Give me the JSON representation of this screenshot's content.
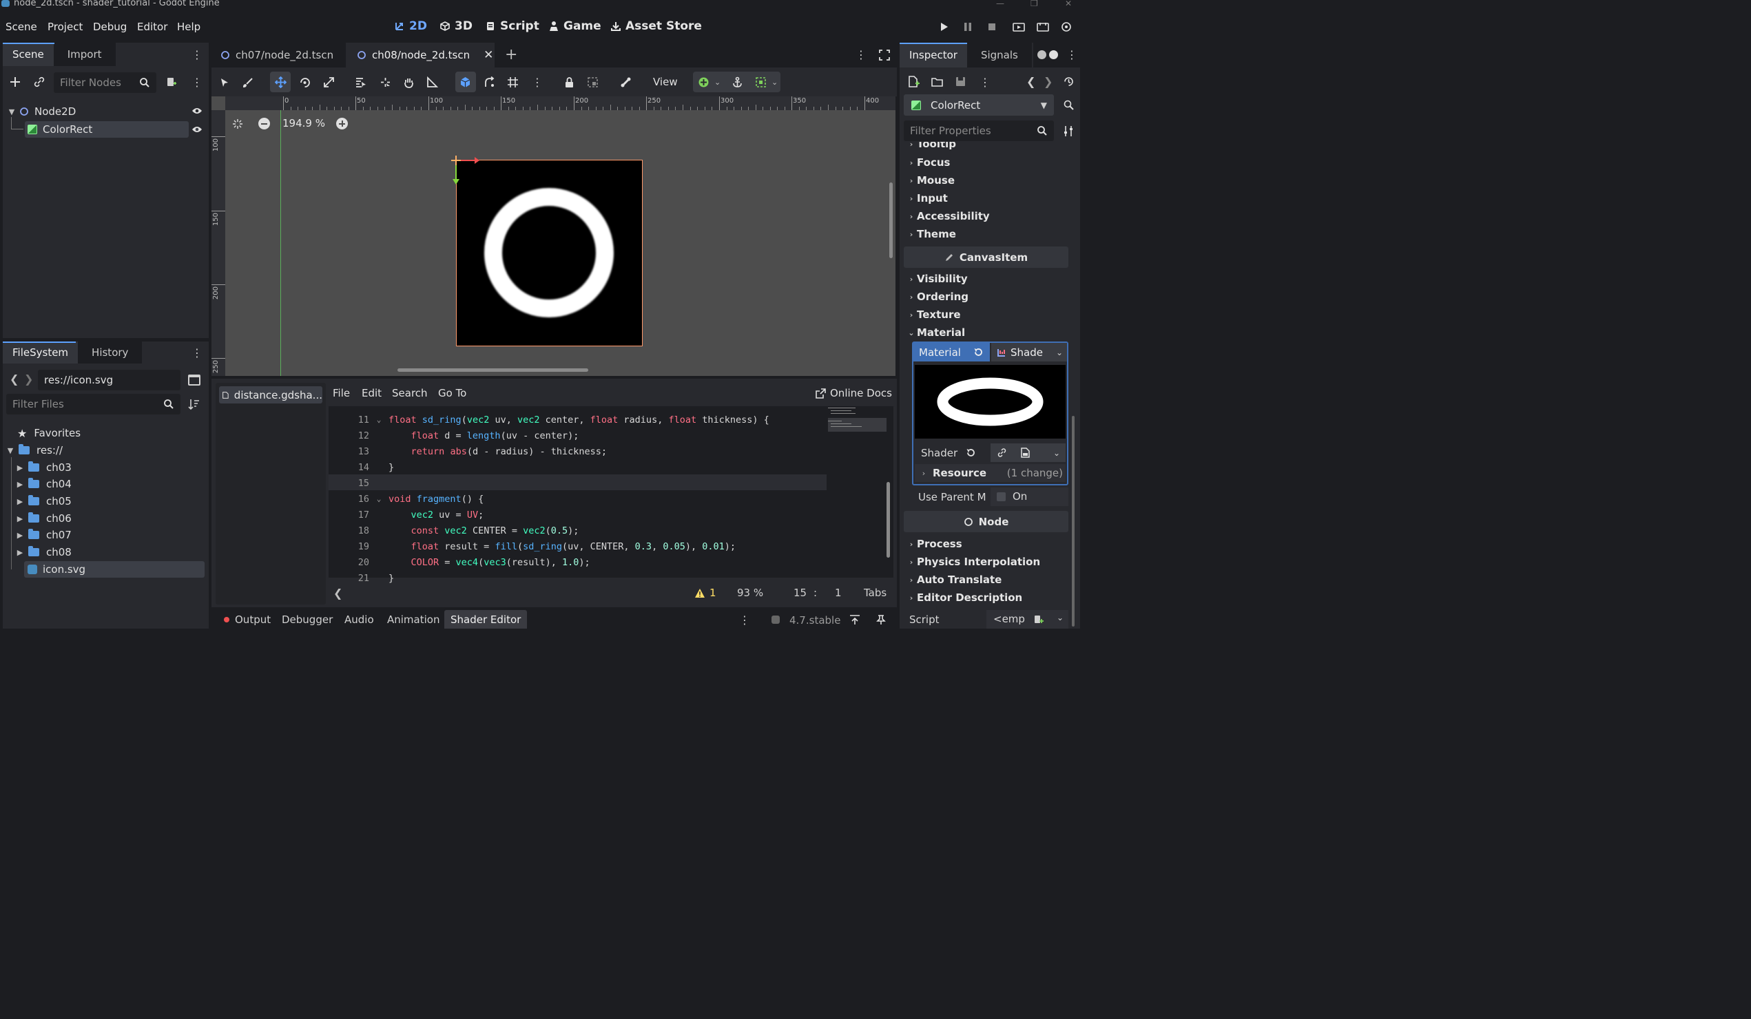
{
  "window": {
    "title": "node_2d.tscn - shader_tutorial - Godot Engine"
  },
  "menu": {
    "items": [
      "Scene",
      "Project",
      "Debug",
      "Editor",
      "Help"
    ]
  },
  "workspaces": [
    {
      "label": "2D",
      "active": true
    },
    {
      "label": "3D",
      "active": false
    },
    {
      "label": "Script",
      "active": false
    },
    {
      "label": "Game",
      "active": false
    },
    {
      "label": "Asset Store",
      "active": false
    }
  ],
  "scene_dock": {
    "tabs": [
      "Scene",
      "Import"
    ],
    "filter_placeholder": "Filter Nodes",
    "nodes": [
      {
        "label": "Node2D",
        "type": "Node2D"
      },
      {
        "label": "ColorRect",
        "type": "ColorRect",
        "selected": true
      }
    ]
  },
  "filesystem_dock": {
    "tabs": [
      "FileSystem",
      "History"
    ],
    "path": "res://icon.svg",
    "filter_placeholder": "Filter Files",
    "favorites_label": "Favorites",
    "root_label": "res://",
    "folders": [
      "ch03",
      "ch04",
      "ch05",
      "ch06",
      "ch07",
      "ch08"
    ],
    "file": "icon.svg"
  },
  "scene_tabs": [
    {
      "label": "ch07/node_2d.tscn",
      "active": false
    },
    {
      "label": "ch08/node_2d.tscn",
      "active": true
    }
  ],
  "toolbar": {
    "view_label": "View"
  },
  "viewport": {
    "zoom_label": "194.9 %",
    "ruler_h": [
      "0",
      "50",
      "100",
      "150",
      "200",
      "250",
      "300",
      "350",
      "400"
    ],
    "ruler_v": [
      "100",
      "150",
      "200",
      "250"
    ]
  },
  "shader_editor": {
    "file_tab": "distance.gdsha...",
    "menu": [
      "File",
      "Edit",
      "Search",
      "Go To"
    ],
    "online_docs": "Online Docs",
    "lines": [
      {
        "n": "11",
        "fold": true,
        "html": "<span class='kw'>float</span> <span class='fn'>sd_ring</span><span class='tx'>(</span><span class='ty'>vec2</span><span class='tx'> uv, </span><span class='ty'>vec2</span><span class='tx'> center, </span><span class='kw'>float</span><span class='tx'> radius, </span><span class='kw'>float</span><span class='tx'> thickness) {</span>"
      },
      {
        "n": "12",
        "fold": false,
        "html": "<span class='tx'>    </span><span class='kw'>float</span><span class='tx'> d = </span><span class='fn'>length</span><span class='tx'>(uv - center);</span>"
      },
      {
        "n": "13",
        "fold": false,
        "html": "<span class='tx'>    </span><span class='kw'>return</span><span class='tx'> </span><span class='kw'>abs</span><span class='tx'>(d - radius) - thickness;</span>"
      },
      {
        "n": "14",
        "fold": false,
        "html": "<span class='tx'>}</span>"
      },
      {
        "n": "15",
        "fold": false,
        "html": ""
      },
      {
        "n": "16",
        "fold": true,
        "html": "<span class='kw'>void</span><span class='tx'> </span><span class='fn'>fragment</span><span class='tx'>() {</span>"
      },
      {
        "n": "17",
        "fold": false,
        "html": "<span class='tx'>    </span><span class='ty'>vec2</span><span class='tx'> uv = </span><span class='kw'>UV</span><span class='tx'>;</span>"
      },
      {
        "n": "18",
        "fold": false,
        "html": "<span class='tx'>    </span><span class='kw'>const</span><span class='tx'> </span><span class='ty'>vec2</span><span class='tx'> CENTER = </span><span class='ty'>vec2</span><span class='tx'>(</span><span class='nm'>0.5</span><span class='tx'>);</span>"
      },
      {
        "n": "19",
        "fold": false,
        "html": "<span class='tx'>    </span><span class='kw'>float</span><span class='tx'> result = </span><span class='fn'>fill</span><span class='tx'>(</span><span class='fn'>sd_ring</span><span class='tx'>(uv, CENTER, </span><span class='nm'>0.3</span><span class='tx'>, </span><span class='nm'>0.05</span><span class='tx'>), </span><span class='nm'>0.01</span><span class='tx'>);</span>"
      },
      {
        "n": "20",
        "fold": false,
        "html": "<span class='tx'>    </span><span class='kw'>COLOR</span><span class='tx'> = </span><span class='ty'>vec4</span><span class='tx'>(</span><span class='ty'>vec3</span><span class='tx'>(result), </span><span class='nm'>1.0</span><span class='tx'>);</span>"
      },
      {
        "n": "21",
        "fold": false,
        "html": "<span class='tx'>}</span>"
      }
    ],
    "status": {
      "warnings": "1",
      "zoom": "93 %",
      "line": "15",
      "sep": ":",
      "col": "1",
      "indent": "Tabs"
    }
  },
  "bottom_tabs": [
    "Output",
    "Debugger",
    "Audio",
    "Animation",
    "Shader Editor"
  ],
  "version": "4.7.stable",
  "inspector": {
    "tabs": [
      "Inspector",
      "Signals"
    ],
    "object": "ColorRect",
    "filter_placeholder": "Filter Properties",
    "sections_top": [
      "Tooltip",
      "Focus",
      "Mouse",
      "Input",
      "Accessibility",
      "Theme"
    ],
    "category_canvasitem": "CanvasItem",
    "sections_canvas": [
      "Visibility",
      "Ordering",
      "Texture",
      "Material"
    ],
    "material_label": "Material",
    "material_value": "Shade",
    "shader_label": "Shader",
    "resource_label": "Resource",
    "resource_changes": "(1 change)",
    "use_parent_label": "Use Parent M",
    "use_parent_value": "On",
    "category_node": "Node",
    "sections_node": [
      "Process",
      "Physics Interpolation",
      "Auto Translate",
      "Editor Description"
    ],
    "script_label": "Script",
    "script_value": "<emp"
  }
}
